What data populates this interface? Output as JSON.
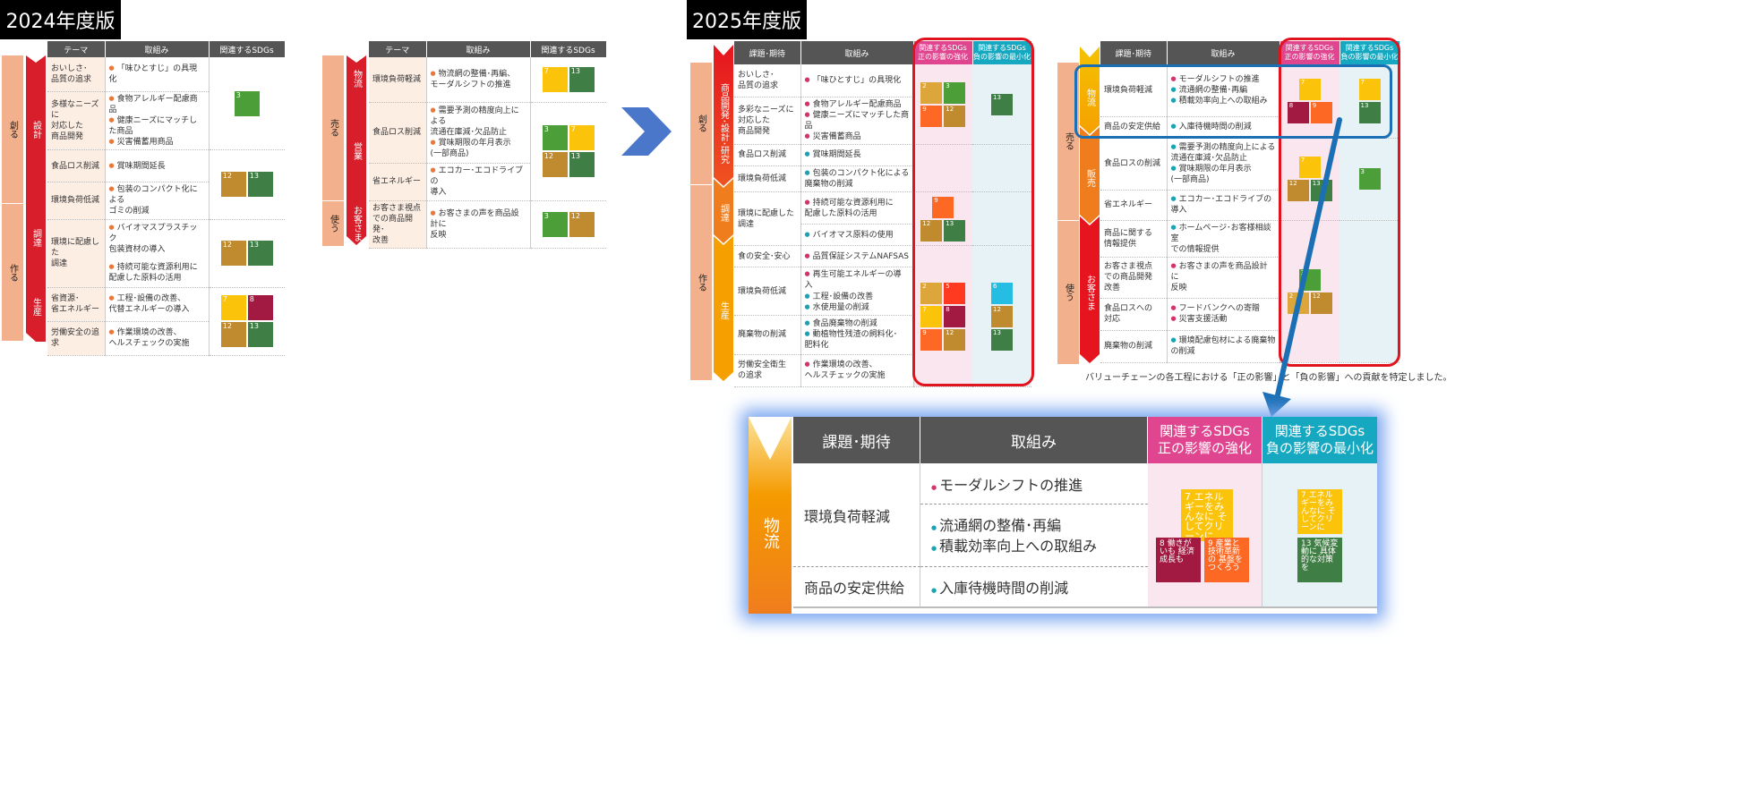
{
  "labels": {
    "v2024": "2024年度版",
    "v2025": "2025年度版"
  },
  "headers": {
    "theme": "テーマ",
    "action": "取組み",
    "sdgs": "関連するSDGs",
    "issue": "課題･期待",
    "pos": "関連するSDGs\n正の影響の強化",
    "neg": "関連するSDGs\n負の影響の最小化"
  },
  "left2024": {
    "create": "創る",
    "design": "設計",
    "make": "作る",
    "procure": "調達",
    "produce": "生産",
    "rows": [
      {
        "t": "おいしさ･\n品質の追求",
        "a": [
          "「味ひとすじ」の具現化"
        ]
      },
      {
        "t": "多様なニーズに\n対応した\n商品開発",
        "a": [
          "食物アレルギー配慮商品",
          "健康ニーズにマッチした商品",
          "災害備蓄用商品"
        ]
      },
      {
        "t": "食品ロス削減",
        "a": [
          "賞味期間延長"
        ]
      },
      {
        "t": "環境負荷低減",
        "a": [
          "包装のコンパクト化による\nゴミの削減"
        ]
      },
      {
        "t": "環境に配慮した\n調達",
        "a": [
          "バイオマスプラスチック\n包装資材の導入",
          "持続可能な資源利用に\n配慮した原料の活用"
        ]
      },
      {
        "t": "省資源･\n省エネルギー",
        "a": [
          "工程･設備の改善、\n代替エネルギーの導入"
        ]
      },
      {
        "t": "労働安全の追求",
        "a": [
          "作業環境の改善、\nヘルスチェックの実施"
        ]
      }
    ]
  },
  "right2024": {
    "sell": "売る",
    "logi": "物流",
    "sales": "営業",
    "use": "使う",
    "cust": "お客さま",
    "rows": [
      {
        "t": "環境負荷軽減",
        "a": [
          "物流網の整備･再編、\nモーダルシフトの推進"
        ]
      },
      {
        "t": "食品ロス削減",
        "a": [
          "需要予測の精度向上による\n流通在庫減･欠品防止",
          "賞味期限の年月表示\n(一部商品)"
        ]
      },
      {
        "t": "省エネルギー",
        "a": [
          "エコカー･エコドライブの\n導入"
        ]
      },
      {
        "t": "お客さま視点\nでの商品開発･\n改善",
        "a": [
          "お客さまの声を商品設計に\n反映"
        ]
      }
    ]
  },
  "left2025": {
    "create": "創る",
    "rnd": "商品開発･設計･研究",
    "make": "作る",
    "procure": "調達",
    "produce": "生産",
    "rows": [
      {
        "t": "おいしさ･\n品質の追求",
        "a": [
          "「味ひとすじ」の具現化"
        ]
      },
      {
        "t": "多彩なニーズに\n対応した\n商品開発",
        "a": [
          "食物アレルギー配慮商品",
          "健康ニーズにマッチした商品",
          "災害備蓄商品"
        ]
      },
      {
        "t": "食品ロス削減",
        "a": [
          "賞味期間延長"
        ]
      },
      {
        "t": "環境負荷低減",
        "a": [
          "包装のコンパクト化による\n廃棄物の削減"
        ]
      },
      {
        "t": "環境に配慮した\n調達",
        "a": [
          "持続可能な資源利用に\n配慮した原料の活用"
        ]
      },
      {
        "t": "",
        "a": [
          "バイオマス原料の使用"
        ]
      },
      {
        "t": "食の安全･安心",
        "a": [
          "品質保証システムNAFSAS"
        ]
      },
      {
        "t": "環境負荷低減",
        "a": [
          "再生可能エネルギーの導入",
          "工程･設備の改善",
          "水使用量の削減"
        ]
      },
      {
        "t": "廃棄物の削減",
        "a": [
          "食品廃棄物の削減",
          "動植物性残渣の飼料化･\n肥料化"
        ]
      },
      {
        "t": "労働安全衛生\nの追求",
        "a": [
          "作業環境の改善、\nヘルスチェックの実施"
        ]
      }
    ]
  },
  "right2025": {
    "sell": "売る",
    "logi": "物流",
    "sales": "販売",
    "use": "使う",
    "cust": "お客さま",
    "rows": [
      {
        "t": "環境負荷軽減",
        "a": [
          "モーダルシフトの推進",
          "流通網の整備･再編",
          "積載効率向上への取組み"
        ]
      },
      {
        "t": "商品の安定供給",
        "a": [
          "入庫待機時間の削減"
        ]
      },
      {
        "t": "食品ロスの削減",
        "a": [
          "需要予測の精度向上による\n流通在庫減･欠品防止",
          "賞味期限の年月表示\n(一部商品)"
        ]
      },
      {
        "t": "省エネルギー",
        "a": [
          "エコカー･エコドライブの\n導入"
        ]
      },
      {
        "t": "商品に関する\n情報提供",
        "a": [
          "ホームページ･お客様相談室\nでの情報提供"
        ]
      },
      {
        "t": "お客さま視点\nでの商品開発\n改善",
        "a": [
          "お客さまの声を商品設計に\n反映"
        ]
      },
      {
        "t": "食品ロスへの\n対応",
        "a": [
          "フードバンクへの寄贈",
          "災害支援活動"
        ]
      },
      {
        "t": "廃棄物の削減",
        "a": [
          "環境配慮包材による廃棄物\nの削減"
        ]
      }
    ]
  },
  "caption": "バリューチェーンの各工程における「正の影響」と「負の影響」への貢献を特定しました。",
  "zoom": {
    "bar": "物流",
    "r1": "環境負荷軽減",
    "r1a": "モーダルシフトの推進",
    "r1b": "流通網の整備･再編",
    "r1c": "積載効率向上への取組み",
    "r2": "商品の安定供給",
    "r2a": "入庫待機時間の削減"
  },
  "icons": {
    "7": "7 エネルギーをみんなに そしてクリーンに",
    "8": "8 働きがいも 経済成長も",
    "9": "9 産業と技術革新の 基盤をつくろう",
    "13": "13 気候変動に 具体的な対策を",
    "3": "3 すべての人に 健康と福祉を",
    "12": "12 つくる責任 つかう責任",
    "2": "2 飢餓を ゼロに",
    "5": "5 ジェンダー平等を 実現しよう",
    "6": "6 安全な水とトイレ を世界中に"
  }
}
